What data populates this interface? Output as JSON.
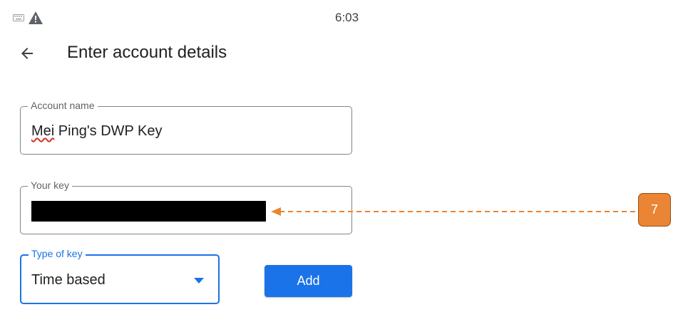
{
  "status_bar": {
    "time": "6:03",
    "icons": [
      "keyboard-icon",
      "warning-icon"
    ]
  },
  "header": {
    "back_icon": "arrow-back-icon",
    "title": "Enter account details"
  },
  "form": {
    "account_name": {
      "label": "Account name",
      "value_misspelled_word": "Mei",
      "value_rest": " Ping's DWP Key"
    },
    "your_key": {
      "label": "Your key",
      "value_redacted": true
    },
    "type_of_key": {
      "label": "Type of key",
      "selected": "Time based",
      "icon": "dropdown-arrow-icon"
    },
    "add_button": "Add"
  },
  "annotation": {
    "badge_number": "7",
    "color": "#e98534"
  },
  "colors": {
    "accent": "#1a73e8",
    "spellcheck": "#d93025",
    "field_border": "#80868b"
  }
}
